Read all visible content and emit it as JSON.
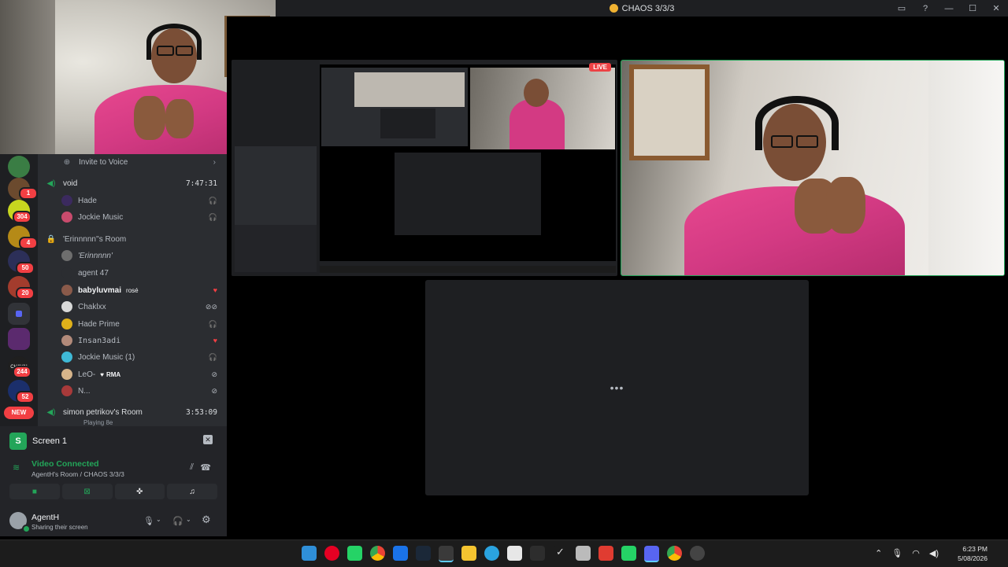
{
  "window": {
    "title": "CHAOS 3/3/3"
  },
  "server_rail": {
    "badges": [
      "1",
      "304",
      "4",
      "50",
      "20",
      "244",
      "52"
    ],
    "new_label": "NEW",
    "server_name_label": "CHAVAI"
  },
  "channels": {
    "invite_label": "Invite to Voice",
    "void_name": "void",
    "void_timer": "7:47:31",
    "void_users": [
      "Hade",
      "Jockie Music"
    ],
    "room_name": "'Erinnnnn''s Room",
    "room_users": [
      "'Erinnnnn'",
      "agent 47",
      "babyluvmai",
      "Chaklxx",
      "Hade Prime",
      "Insan3adi",
      "Jockie Music (1)",
      "LeO-",
      "N..."
    ],
    "babyluvmai_tag": "rosé",
    "leo_tag": "RMA",
    "simon_room": "simon petrikov's Room",
    "simon_timer": "3:53:09",
    "simon_sub": "Playing 8e"
  },
  "voice_panel": {
    "screen_label": "Screen 1",
    "screen_icon_letter": "S",
    "status_title": "Video Connected",
    "status_sub": "AgentH's Room / CHAOS 3/3/3",
    "user_name": "AgentH",
    "user_status": "Sharing their screen"
  },
  "stage": {
    "live_label": "LIVE",
    "loading_dots": "•••"
  },
  "taskbar": {
    "time": "6:23 PM",
    "date": "5/08/2026"
  },
  "colors": {
    "accent_green": "#23a559",
    "live_red": "#ed4245",
    "badge_red": "#f23f43",
    "channel_bg": "#2b2d31",
    "rail_bg": "#1e1f22"
  }
}
